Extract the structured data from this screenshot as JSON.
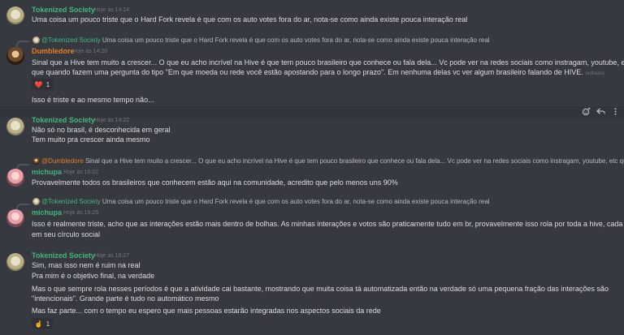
{
  "messages": [
    {
      "author": "Tokenized Society",
      "time": "Hoje às 14:14",
      "lines": [
        "Uma coisa um pouco triste que o Hard Fork revela é que com os auto votes fora do ar, nota-se como ainda existe pouca interação real"
      ]
    },
    {
      "reply_name": "@Tokenized Society",
      "reply_text": "Uma coisa um pouco triste que o Hard Fork revela é que com os auto votes fora do ar, nota-se como ainda existe pouca interação real",
      "author": "Dumbledore",
      "time": "Hoje às 14:20",
      "lines": [
        "Sinal que a Hive tem muito a crescer... O que eu acho incrível na Hive é que tem pouco brasileiro que conhece ou fala dela... Vc pode ver na redes sociais como instragam, youtube, etc",
        "que quando fazem uma pergunta do tipo \"Em que moeda ou rede você estão apostando para o longo prazo\". Em nenhuma delas vc ver algum brasileiro falando de HIVE."
      ],
      "edited": "(editado)",
      "reaction_emoji": "❤️",
      "reaction_count": "1",
      "extra": "Isso é triste e ao mesmo tempo não..."
    },
    {
      "author": "Tokenized Society",
      "time": "Hoje às 14:22",
      "lines": [
        "Não só no brasil, é desconhecida em geral",
        "Tem muito pra crescer ainda mesmo"
      ]
    },
    {
      "reply_name": "@Dumbledore",
      "reply_text": "Sinal que a Hive tem muito a crescer... O que eu acho incrível na Hive é que tem pouco brasileiro que conhece ou fala dela... Vc pode ver na redes sociais como instragam, youtube, etc que quan...",
      "author": "michupa",
      "time": "Hoje às 16:22",
      "lines": [
        "Provavelmente todos os brasileiros que conhecem estão aqui na comunidade, acredito que pelo menos uns 90%"
      ]
    },
    {
      "reply_name": "@Tokenized Society",
      "reply_text": "Uma coisa um pouco triste que o Hard Fork revela é que com os auto votes fora do ar, nota-se como ainda existe pouca interação real",
      "author": "michupa",
      "time": "Hoje às 16:25",
      "lines": [
        "Isso é realmente triste, acho que as interações estão mais dentro de bolhas. As minhas interações e votos são praticamente tudo em br, provavelmente isso rola por toda a hive, cada um",
        "em seu círculo social"
      ]
    },
    {
      "author": "Tokenized Society",
      "time": "Hoje às 16:27",
      "lines": [
        "Sim, mas isso nem é ruim na real",
        "Pra mim é o objetivo final, na verdade"
      ],
      "para2": [
        "Mas o que sempre rola nesses períodos é que a atividade cai bastante, mostrando que muita coisa tá automatizada então na verdade só uma pequena fração das interações são",
        "\"intencionais\". Grande parte é tudo no automático mesmo"
      ],
      "para3": "Mas faz parte... com o tempo eu espero que mais pessoas estarão integradas nos aspectos sociais da rede",
      "reaction_emoji": "☝️",
      "reaction_count": "1"
    }
  ],
  "toolbar": {
    "icons": [
      "add-reaction-icon",
      "reply-icon",
      "more-icon"
    ]
  },
  "colors": {
    "background": "#36393f",
    "green_name": "#43b581",
    "orange_name": "#e67e22"
  }
}
